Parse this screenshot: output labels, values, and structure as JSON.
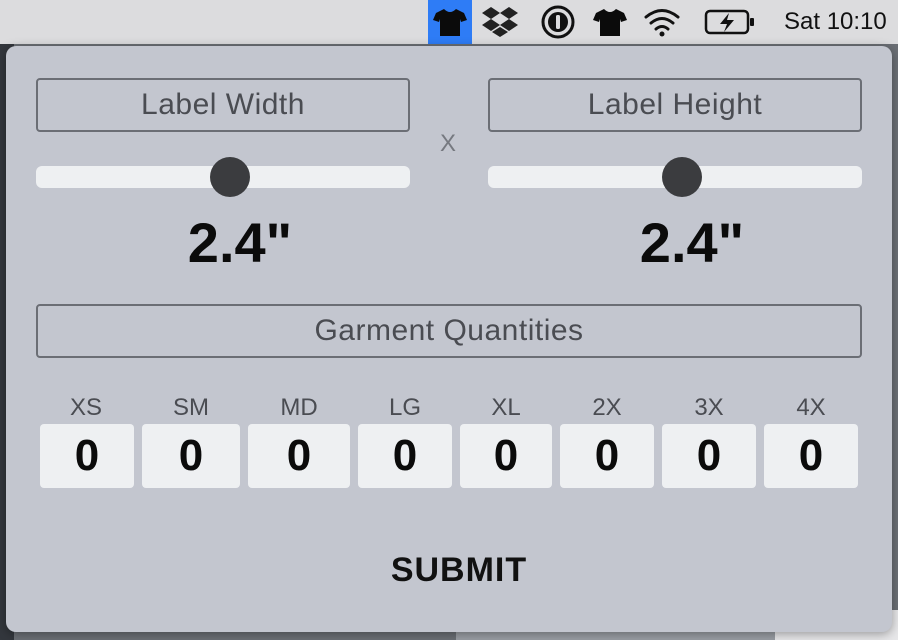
{
  "menubar": {
    "icons": [
      "tshirt-app-icon",
      "dropbox-icon",
      "onepassword-icon",
      "tshirt-icon",
      "wifi-icon",
      "battery-charging-icon"
    ],
    "clock": "Sat 10:10"
  },
  "dimensions": {
    "width_label": "Label Width",
    "height_label": "Label Height",
    "separator": "X",
    "width_value": "2.4\"",
    "height_value": "2.4\"",
    "width_slider_fraction": 0.52,
    "height_slider_fraction": 0.52
  },
  "quantities": {
    "title": "Garment Quantities",
    "sizes": [
      {
        "label": "XS",
        "value": "0"
      },
      {
        "label": "SM",
        "value": "0"
      },
      {
        "label": "MD",
        "value": "0"
      },
      {
        "label": "LG",
        "value": "0"
      },
      {
        "label": "XL",
        "value": "0"
      },
      {
        "label": "2X",
        "value": "0"
      },
      {
        "label": "3X",
        "value": "0"
      },
      {
        "label": "4X",
        "value": "0"
      }
    ]
  },
  "submit_label": "SUBMIT",
  "colors": {
    "menubar_active": "#2e7cf6",
    "popover_bg": "#c3c6cf",
    "field_bg": "#eef0f2",
    "thumb": "#3b3c3f"
  }
}
